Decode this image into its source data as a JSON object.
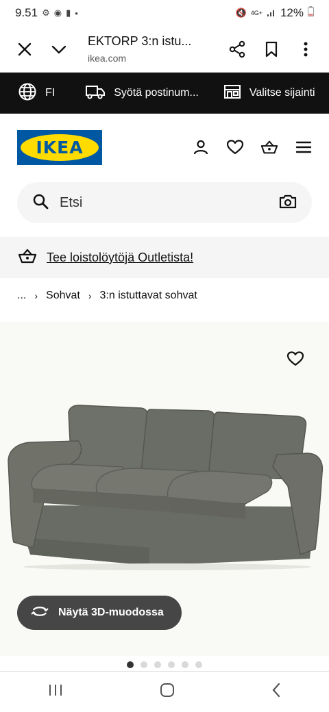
{
  "status_bar": {
    "time": "9.51",
    "network": "4G+",
    "battery": "12%"
  },
  "browser": {
    "page_title": "EKTORP 3:n istu...",
    "url": "ikea.com"
  },
  "top_bar": {
    "language": "FI",
    "postcode_label": "Syötä postinum...",
    "store_label": "Valitse sijainti"
  },
  "header": {
    "logo_text": "IKEA"
  },
  "search": {
    "placeholder": "Etsi"
  },
  "promo": {
    "text": "Tee loistolöytöjä Outletista!"
  },
  "breadcrumb": {
    "ellipsis": "...",
    "items": [
      "Sohvat",
      "3:n istuttavat sohvat"
    ]
  },
  "gallery": {
    "view_3d_label": "Näytä 3D-muodossa",
    "image_count": 6,
    "active_index": 0
  },
  "colors": {
    "ikea_blue": "#0058a3",
    "ikea_yellow": "#ffdb00",
    "topbar_bg": "#111111",
    "button_3d_bg": "#464646",
    "sofa_gray": "#6b6d66"
  }
}
